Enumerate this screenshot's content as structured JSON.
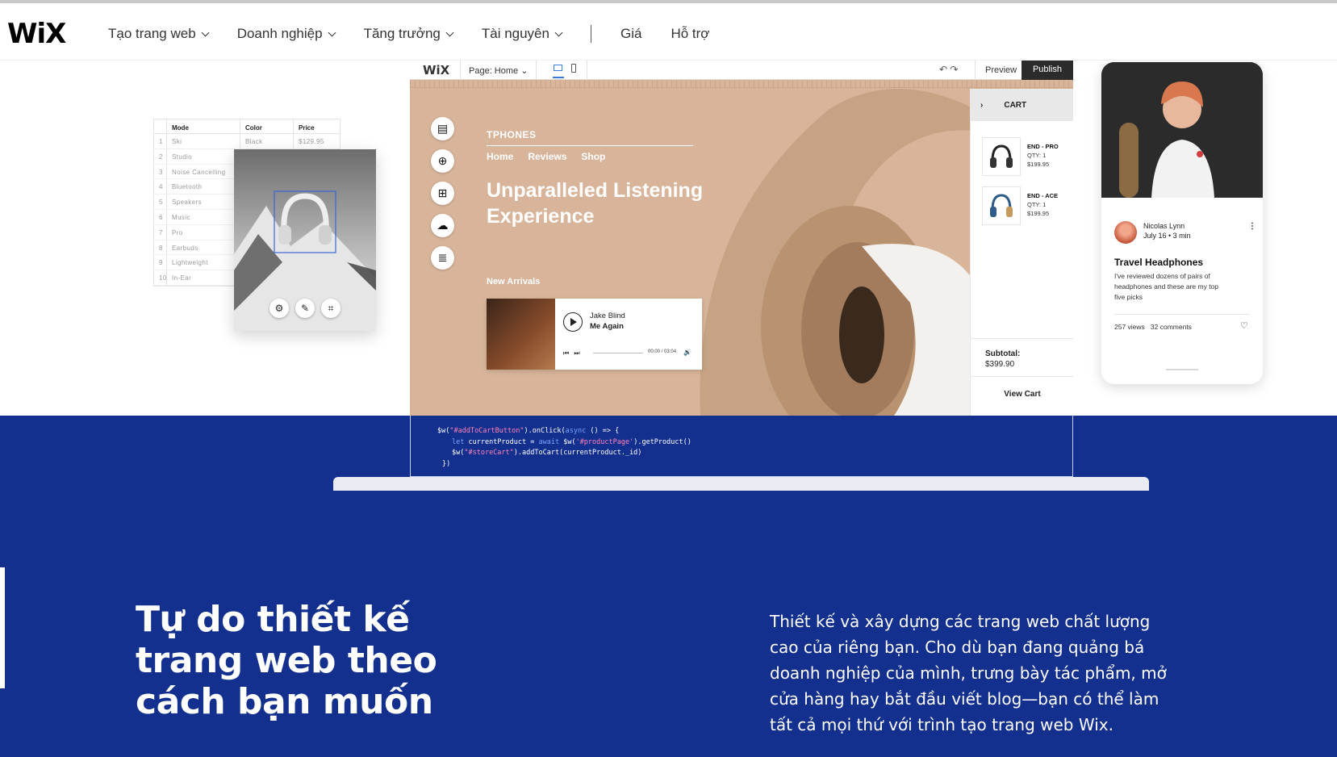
{
  "nav": {
    "logo": "WiX",
    "items": [
      "Tạo trang web",
      "Doanh nghiệp",
      "Tăng trưởng",
      "Tài nguyên"
    ],
    "links": [
      "Giá",
      "Hỗ trợ"
    ]
  },
  "table": {
    "headers": [
      "Mode",
      "Color",
      "Price"
    ],
    "rows": [
      [
        "1",
        "Ski",
        "Black",
        "$129.95"
      ],
      [
        "2",
        "Studio",
        "",
        ""
      ],
      [
        "3",
        "Noise Cancelling",
        "",
        ""
      ],
      [
        "4",
        "Bluetooth",
        "",
        ""
      ],
      [
        "5",
        "Speakers",
        "",
        ""
      ],
      [
        "6",
        "Music",
        "",
        ""
      ],
      [
        "7",
        "Pro",
        "",
        ""
      ],
      [
        "8",
        "Earbuds",
        "",
        ""
      ],
      [
        "9",
        "Lightweight",
        "",
        ""
      ],
      [
        "10",
        "In-Ear",
        "",
        ""
      ]
    ]
  },
  "editor": {
    "logo": "WiX",
    "page_label": "Page: Home",
    "preview": "Preview",
    "publish": "Publish",
    "site": {
      "brand": "TPHONES",
      "nav": [
        "Home",
        "Reviews",
        "Shop"
      ],
      "headline": "Unparalleled Listening Experience",
      "new_arrivals": "New Arrivals",
      "player": {
        "artist": "Jake Blind",
        "song": "Me Again",
        "time": "00:00 / 03:04"
      }
    },
    "cart": {
      "title": "CART",
      "items": [
        {
          "name": "END - PRO",
          "qty": "QTY: 1",
          "price": "$199.95"
        },
        {
          "name": "END - ACE",
          "qty": "QTY: 1",
          "price": "$199.95"
        }
      ],
      "subtotal_label": "Subtotal:",
      "subtotal": "$399.90",
      "view_cart": "View Cart"
    }
  },
  "blog": {
    "author": "Nicolas Lynn",
    "meta": "July 16 • 3 min",
    "title": "Travel Headphones",
    "body": "I've reviewed dozens of pairs of headphones and these are my top five picks",
    "views": "257 views",
    "comments": "32 comments"
  },
  "code": {
    "line1_a": "$w(",
    "line1_s": "\"#addToCartButton\"",
    "line1_b": ").onClick(",
    "line1_k": "async",
    "line1_c": " () => {",
    "line2_k1": "let",
    "line2_a": " currentProduct = ",
    "line2_k2": "await",
    "line2_b": " $w(",
    "line2_s": "'#productPage'",
    "line2_c": ").getProduct()",
    "line3_a": "$w(",
    "line3_s": "\"#storeCart\"",
    "line3_b": ").addToCart(currentProduct._id)",
    "line4": "})"
  },
  "section": {
    "headline": "Tự do thiết kế trang web theo cách bạn muốn",
    "description": "Thiết kế và xây dựng các trang web chất lượng cao của riêng bạn. Cho dù bạn đang quảng bá doanh nghiệp của mình, trưng bày tác phẩm, mở cửa hàng hay bắt đầu viết blog—bạn có thể làm tất cả mọi thứ với trình tạo trang web Wix."
  },
  "colors": {
    "blue_band": "#13308e",
    "hero_tan": "#d8b59a"
  }
}
